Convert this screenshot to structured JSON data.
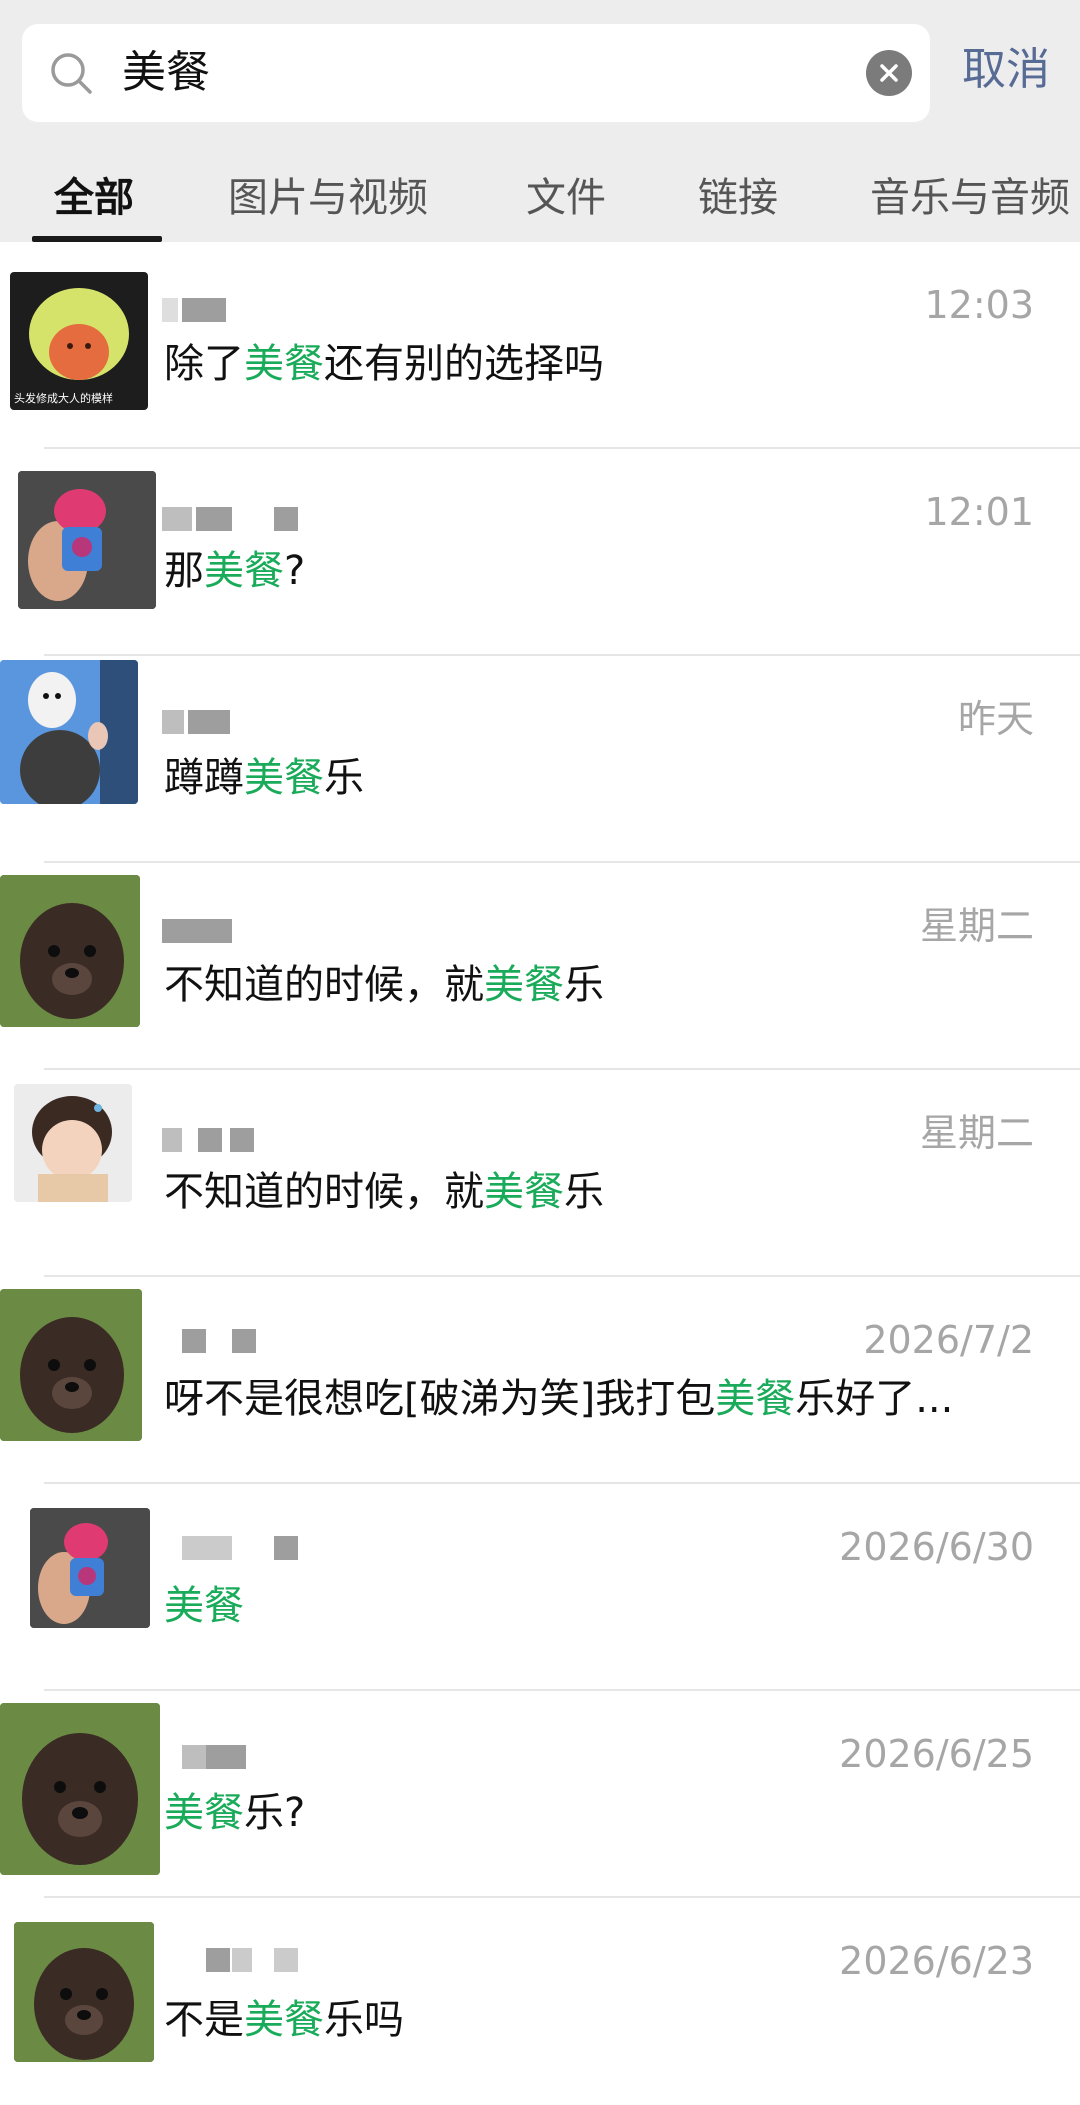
{
  "search": {
    "query": "美餐",
    "cancel_label": "取消"
  },
  "tabs": [
    {
      "label": "全部"
    },
    {
      "label": "图片与视频"
    },
    {
      "label": "文件"
    },
    {
      "label": "链接"
    },
    {
      "label": "音乐与音频"
    }
  ],
  "colors": {
    "highlight": "#1aab5a",
    "cancel": "#576b95"
  },
  "results": [
    {
      "time": "12:03",
      "pre": "除了",
      "hit": "美餐",
      "post": "还有别的选择吗",
      "avatar_caption": "头发修成大人的模样"
    },
    {
      "time": "12:01",
      "pre": "那",
      "hit": "美餐",
      "post": "?"
    },
    {
      "time": "昨天",
      "pre": "蹲蹲",
      "hit": "美餐",
      "post": "乐"
    },
    {
      "time": "星期二",
      "pre": "不知道的时候，就",
      "hit": "美餐",
      "post": "乐"
    },
    {
      "time": "星期二",
      "pre": "不知道的时候，就",
      "hit": "美餐",
      "post": "乐"
    },
    {
      "time": "2026/7/2",
      "pre": "呀不是很想吃[破涕为笑]我打包",
      "hit": "美餐",
      "post": "乐好了..."
    },
    {
      "time": "2026/6/30",
      "pre": "",
      "hit": "美餐",
      "post": ""
    },
    {
      "time": "2026/6/25",
      "pre": "",
      "hit": "美餐",
      "post": "乐?"
    },
    {
      "time": "2026/6/23",
      "pre": "不是",
      "hit": "美餐",
      "post": "乐吗"
    }
  ]
}
